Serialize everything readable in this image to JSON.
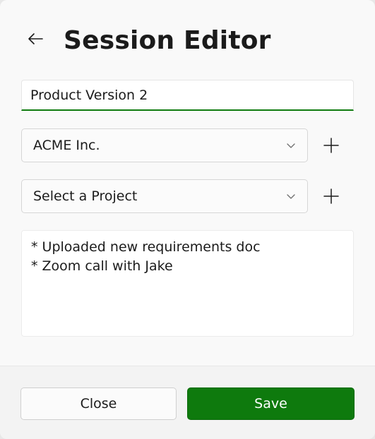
{
  "header": {
    "title": "Session Editor",
    "back_icon": "arrow-left-icon"
  },
  "form": {
    "session_name": {
      "value": "Product Version 2"
    },
    "client_combo": {
      "selected": "ACME Inc.",
      "chevron_icon": "chevron-down-icon",
      "add_icon": "plus-icon"
    },
    "project_combo": {
      "placeholder": "Select a Project",
      "chevron_icon": "chevron-down-icon",
      "add_icon": "plus-icon"
    },
    "notes": {
      "lines": [
        "* Uploaded new requirements doc",
        "* Zoom call with Jake"
      ]
    }
  },
  "footer": {
    "close_label": "Close",
    "save_label": "Save"
  },
  "colors": {
    "accent": "#0e7a0d",
    "text": "#1b1b1b",
    "background": "#f9f9f9"
  }
}
